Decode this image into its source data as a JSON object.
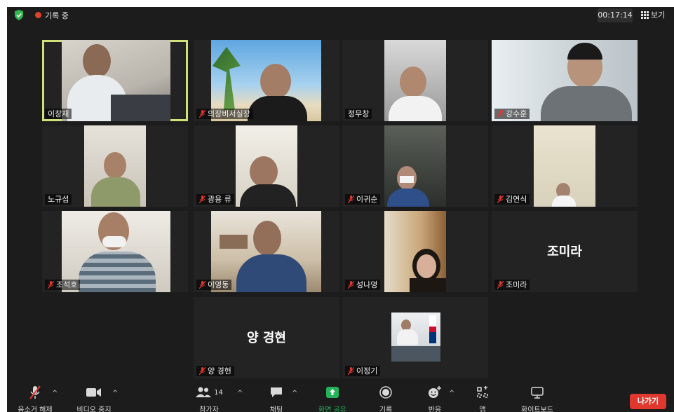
{
  "topbar": {
    "recording_label": "기록 중",
    "timer": "00:17:14",
    "view_label": "보기"
  },
  "tiles": [
    {
      "name": "이창재",
      "muted": false,
      "active": true,
      "video": true
    },
    {
      "name": "의장비서실장",
      "muted": true,
      "video": true
    },
    {
      "name": "정무창",
      "muted": false,
      "video": true
    },
    {
      "name": "강수훈",
      "muted": true,
      "video": true
    },
    {
      "name": "노규섭",
      "muted": false,
      "video": true
    },
    {
      "name": "광용 류",
      "muted": true,
      "video": true
    },
    {
      "name": "이귀순",
      "muted": true,
      "video": true
    },
    {
      "name": "김연식",
      "muted": true,
      "video": true
    },
    {
      "name": "조석호",
      "muted": true,
      "video": true
    },
    {
      "name": "이영동",
      "muted": true,
      "video": true
    },
    {
      "name": "성나영",
      "muted": true,
      "video": true
    },
    {
      "name": "조미라",
      "muted": true,
      "video": false,
      "display_name": "조미라"
    },
    {
      "name": "양 경현",
      "muted": true,
      "video": false,
      "display_name": "양 경현"
    },
    {
      "name": "이정기",
      "muted": true,
      "video": true
    }
  ],
  "toolbar": {
    "mute_label": "음소거 해제",
    "video_label": "비디오 중지",
    "participants_label": "참가자",
    "participants_count": "14",
    "chat_label": "채팅",
    "share_label": "화면 공유",
    "record_label": "기록",
    "reactions_label": "반응",
    "apps_label": "앱",
    "whiteboard_label": "화이트보드",
    "leave_label": "나가기"
  },
  "colors": {
    "background": "#1c1c1c",
    "tile": "#232323",
    "active_border": "#d2e07a",
    "muted_icon": "#e0382e",
    "share_green": "#24b35a",
    "leave_button": "#e0382e"
  }
}
